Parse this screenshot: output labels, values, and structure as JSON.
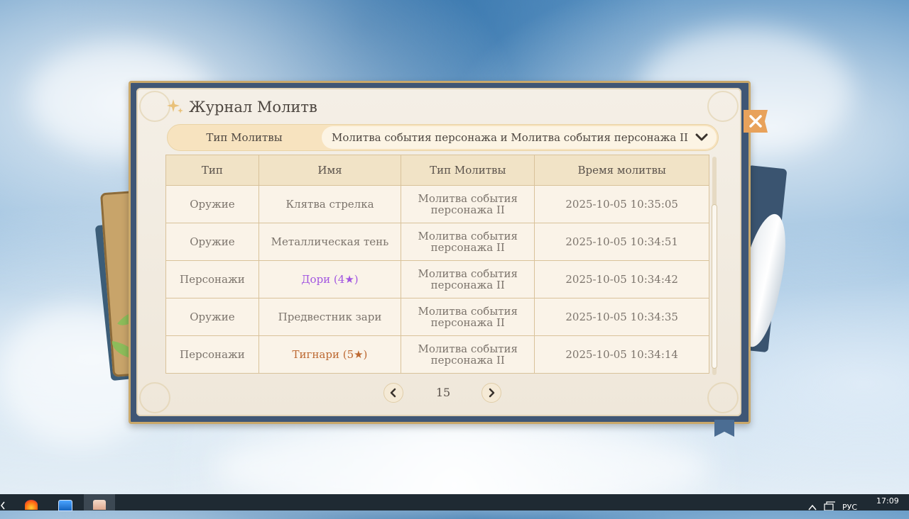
{
  "window": {
    "title": "Журнал Молитв"
  },
  "selector": {
    "label": "Тип Молитвы",
    "value": "Молитва события персонажа и Молитва события персонажа II"
  },
  "table": {
    "headers": [
      "Тип",
      "Имя",
      "Тип Молитвы",
      "Время молитвы"
    ],
    "rows": [
      {
        "type": "Оружие",
        "name": "Клятва стрелка",
        "wish_type": "Молитва события персонажа II",
        "time": "2025-10-05 10:35:05",
        "rarity_color": "#7c746c"
      },
      {
        "type": "Оружие",
        "name": "Металлическая тень",
        "wish_type": "Молитва события персонажа II",
        "time": "2025-10-05 10:34:51",
        "rarity_color": "#7c746c"
      },
      {
        "type": "Персонажи",
        "name": "Дори (4★)",
        "wish_type": "Молитва события персонажа II",
        "time": "2025-10-05 10:34:42",
        "rarity_color": "#a256e1"
      },
      {
        "type": "Оружие",
        "name": "Предвестник зари",
        "wish_type": "Молитва события персонажа II",
        "time": "2025-10-05 10:34:35",
        "rarity_color": "#7c746c"
      },
      {
        "type": "Персонажи",
        "name": "Тигнари (5★)",
        "wish_type": "Молитва события персонажа II",
        "time": "2025-10-05 10:34:14",
        "rarity_color": "#bd6932"
      }
    ]
  },
  "pagination": {
    "page": "15"
  },
  "taskbar": {
    "apps": [
      "firefox-icon",
      "computer-icon",
      "game-icon"
    ],
    "language": "РУС",
    "clock": "17:09"
  },
  "colors": {
    "accent": "#e8a25b",
    "frame": "#3f5675",
    "four_star": "#a256e1",
    "five_star": "#bd6932"
  }
}
